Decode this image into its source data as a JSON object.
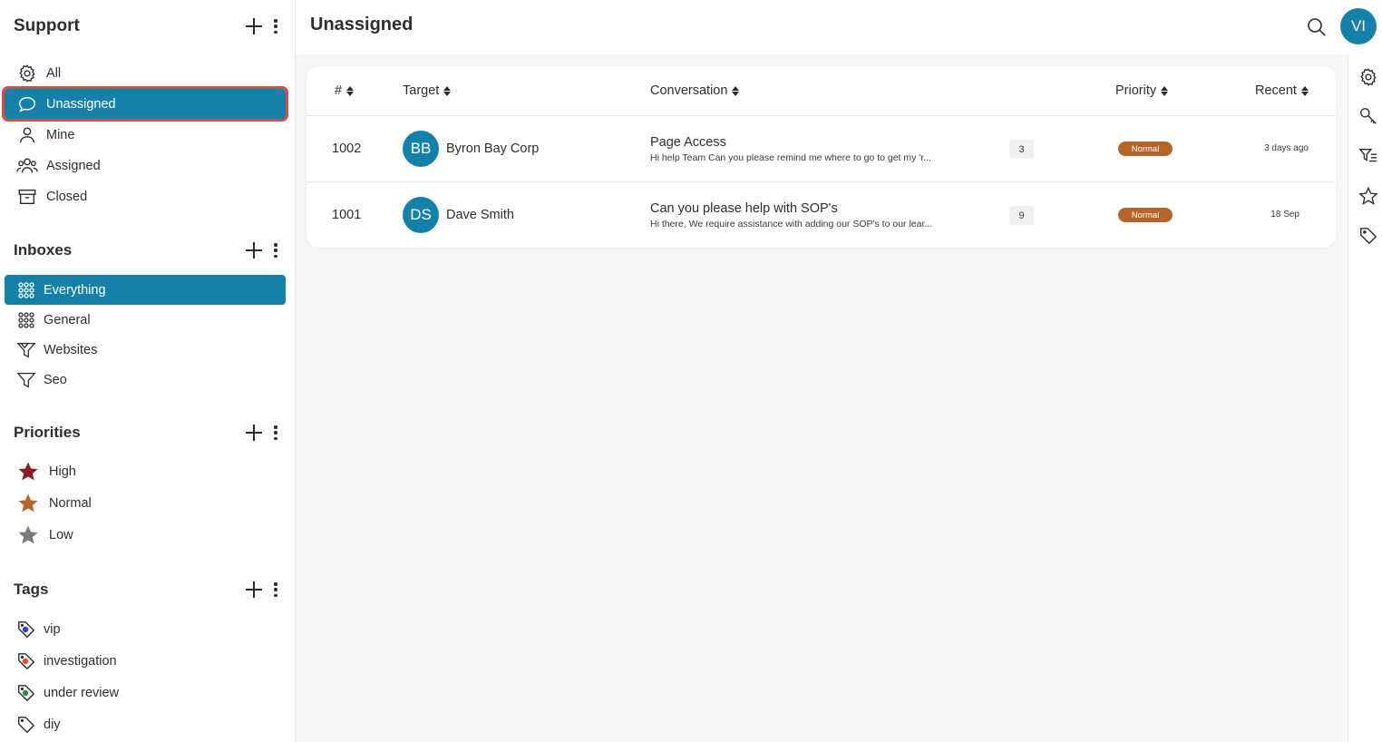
{
  "sidebar": {
    "support": {
      "title": "Support",
      "items": [
        {
          "label": "All",
          "icon": "gear-icon"
        },
        {
          "label": "Unassigned",
          "icon": "chat-bubble-icon"
        },
        {
          "label": "Mine",
          "icon": "person-icon"
        },
        {
          "label": "Assigned",
          "icon": "people-icon"
        },
        {
          "label": "Closed",
          "icon": "archive-box-icon"
        }
      ]
    },
    "inboxes": {
      "title": "Inboxes",
      "items": [
        {
          "label": "Everything",
          "icon": "grid-icon"
        },
        {
          "label": "General",
          "icon": "grid-icon"
        },
        {
          "label": "Websites",
          "icon": "filter-icon"
        },
        {
          "label": "Seo",
          "icon": "filter-icon"
        }
      ]
    },
    "priorities": {
      "title": "Priorities",
      "items": [
        {
          "label": "High",
          "icon": "star-icon",
          "color": "#8b1c22"
        },
        {
          "label": "Normal",
          "icon": "star-icon",
          "color": "#b5652a"
        },
        {
          "label": "Low",
          "icon": "star-icon",
          "color": "#7a7a7a"
        }
      ]
    },
    "tags": {
      "title": "Tags",
      "items": [
        {
          "label": "vip",
          "icon": "tag-icon",
          "color": "#2a44d6"
        },
        {
          "label": "investigation",
          "icon": "tag-icon",
          "color": "#e05030"
        },
        {
          "label": "under review",
          "icon": "tag-icon",
          "color": "#2e8b3a"
        },
        {
          "label": "diy",
          "icon": "tag-icon",
          "color": ""
        }
      ]
    }
  },
  "header": {
    "title": "Unassigned",
    "avatar_initials": "VI"
  },
  "table": {
    "columns": [
      "#",
      "Target",
      "Conversation",
      "Priority",
      "Recent"
    ],
    "rows": [
      {
        "id": "1002",
        "initials": "BB",
        "target": "Byron Bay Corp",
        "subject": "Page Access",
        "preview": "Hi help Team Can you please remind me where to go to get my 'r...",
        "count": "3",
        "priority": "Normal",
        "recent": "3 days ago"
      },
      {
        "id": "1001",
        "initials": "DS",
        "target": "Dave Smith",
        "subject": "Can you please help with SOP's",
        "preview": "Hi there, We require assistance with adding our SOP's to our lear...",
        "count": "9",
        "priority": "Normal",
        "recent": "18 Sep"
      }
    ]
  },
  "colors": {
    "accent": "#1681a8",
    "highlight_outline": "#e0474c",
    "priority_normal": "#b5652a"
  },
  "rail": {
    "icons": [
      "gear-icon",
      "key-icon",
      "filter-list-icon",
      "star-icon",
      "tag-icon"
    ]
  }
}
